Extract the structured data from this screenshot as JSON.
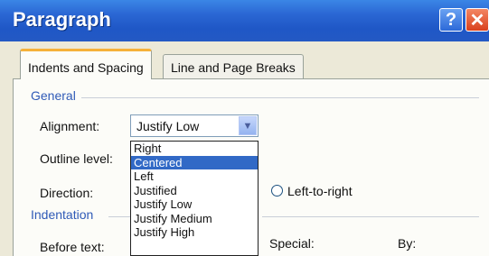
{
  "window": {
    "title": "Paragraph"
  },
  "titlebar_buttons": {
    "help": "?",
    "close": "✕"
  },
  "tabs": [
    {
      "label": "Indents and Spacing",
      "active": true
    },
    {
      "label": "Line and Page Breaks",
      "active": false
    }
  ],
  "general": {
    "section_label": "General",
    "alignment_label": "Alignment:",
    "alignment_value": "Justify Low",
    "outline_label": "Outline level:",
    "direction_label": "Direction:",
    "direction_option": "Left-to-right"
  },
  "alignment_options": [
    "Right",
    "Centered",
    "Left",
    "Justified",
    "Justify Low",
    "Justify Medium",
    "Justify High"
  ],
  "alignment_highlighted": "Centered",
  "indentation": {
    "section_label": "Indentation",
    "before_text_label": "Before text:",
    "special_label": "Special:",
    "by_label": "By:"
  },
  "colors": {
    "titlebar": "#2a66d3",
    "section_text": "#2f5ab7",
    "selection": "#3169c6",
    "tab_accent": "#f5b13a"
  }
}
